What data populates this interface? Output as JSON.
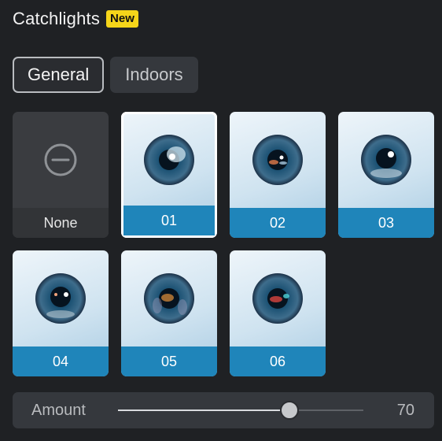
{
  "header": {
    "title": "Catchlights",
    "badge": "New"
  },
  "tabs": [
    {
      "label": "General",
      "active": true
    },
    {
      "label": "Indoors",
      "active": false
    }
  ],
  "presets": [
    {
      "label": "None",
      "type": "none",
      "selected": false
    },
    {
      "label": "01",
      "type": "eye",
      "selected": true
    },
    {
      "label": "02",
      "type": "eye",
      "selected": false
    },
    {
      "label": "03",
      "type": "eye",
      "selected": false
    },
    {
      "label": "04",
      "type": "eye",
      "selected": false
    },
    {
      "label": "05",
      "type": "eye",
      "selected": false
    },
    {
      "label": "06",
      "type": "eye",
      "selected": false
    }
  ],
  "amount": {
    "label": "Amount",
    "value": "70",
    "fraction": 0.7
  },
  "colors": {
    "accent": "#1f85ba",
    "badge": "#f5d51a",
    "panel": "#1f2124"
  }
}
